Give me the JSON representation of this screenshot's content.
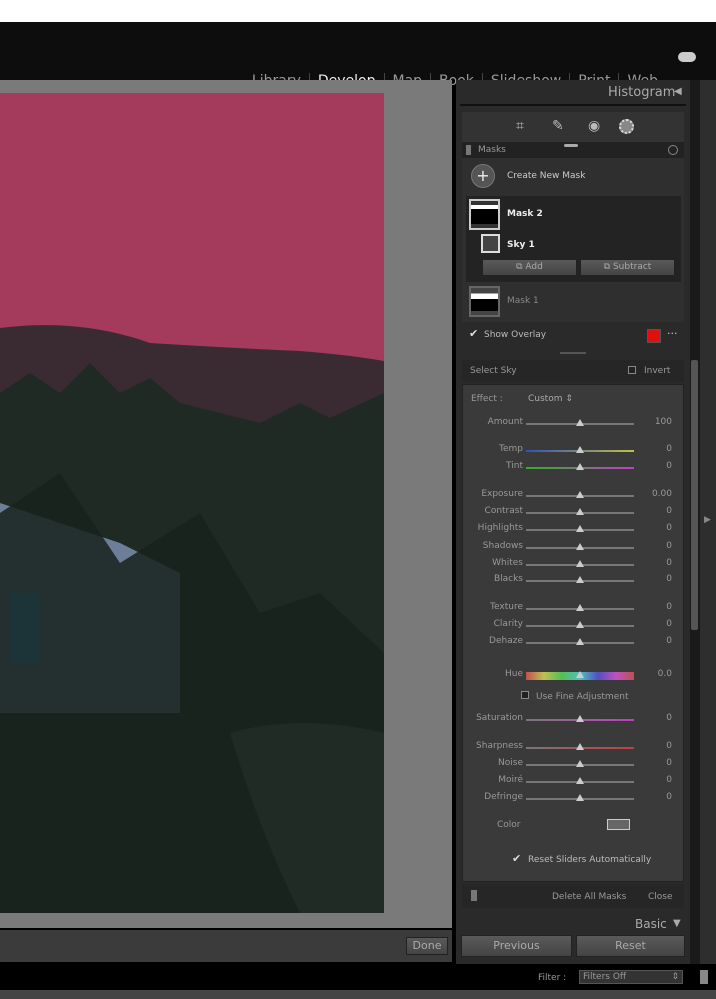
{
  "modules": [
    "Library",
    "Develop",
    "Map",
    "Book",
    "Slideshow",
    "Print",
    "Web"
  ],
  "active_module": "Develop",
  "panel": {
    "histogram": "Histogram",
    "basic": "Basic"
  },
  "masks": {
    "title": "Masks",
    "create": "Create New Mask",
    "mask2": "Mask 2",
    "sky1": "Sky 1",
    "add": "Add",
    "subtract": "Subtract",
    "mask1": "Mask 1",
    "show_overlay": "Show Overlay",
    "overlay_color": "#e01010"
  },
  "select": {
    "label": "Select Sky",
    "invert": "Invert"
  },
  "effect": {
    "label": "Effect :",
    "value": "Custom"
  },
  "sliders": [
    {
      "name": "Amount",
      "value": "100",
      "pos": 0.5,
      "group": 0
    },
    {
      "name": "Temp",
      "value": "0",
      "pos": 0.5,
      "group": 1,
      "track": "linear-gradient(90deg,#3050c0,#c0c040)"
    },
    {
      "name": "Tint",
      "value": "0",
      "pos": 0.5,
      "group": 1,
      "track": "linear-gradient(90deg,#30b030,#c040c0)"
    },
    {
      "name": "Exposure",
      "value": "0.00",
      "pos": 0.5,
      "group": 2
    },
    {
      "name": "Contrast",
      "value": "0",
      "pos": 0.5,
      "group": 2
    },
    {
      "name": "Highlights",
      "value": "0",
      "pos": 0.5,
      "group": 2
    },
    {
      "name": "Shadows",
      "value": "0",
      "pos": 0.5,
      "group": 2
    },
    {
      "name": "Whites",
      "value": "0",
      "pos": 0.5,
      "group": 2
    },
    {
      "name": "Blacks",
      "value": "0",
      "pos": 0.5,
      "group": 2
    },
    {
      "name": "Texture",
      "value": "0",
      "pos": 0.5,
      "group": 3
    },
    {
      "name": "Clarity",
      "value": "0",
      "pos": 0.5,
      "group": 3
    },
    {
      "name": "Dehaze",
      "value": "0",
      "pos": 0.5,
      "group": 3
    },
    {
      "name": "Hue",
      "value": "0.0",
      "pos": 0.5,
      "group": 4,
      "track": "linear-gradient(90deg,#c05050,#c0c050,#50c050,#50c0c0,#5050c0,#c050c0,#c05050)"
    },
    {
      "name": "Saturation",
      "value": "0",
      "pos": 0.5,
      "group": 5,
      "track": "linear-gradient(90deg,#777,#c040c0)"
    },
    {
      "name": "Sharpness",
      "value": "0",
      "pos": 0.5,
      "group": 6,
      "track": "linear-gradient(90deg,#777,#c04040)"
    },
    {
      "name": "Noise",
      "value": "0",
      "pos": 0.5,
      "group": 6
    },
    {
      "name": "Moiré",
      "value": "0",
      "pos": 0.5,
      "group": 6
    },
    {
      "name": "Defringe",
      "value": "0",
      "pos": 0.5,
      "group": 6
    }
  ],
  "fine_adjust": "Use Fine Adjustment",
  "color_label": "Color",
  "reset_auto": "Reset Sliders Automatically",
  "delete_all": "Delete All Masks",
  "close": "Close",
  "done": "Done",
  "previous": "Previous",
  "reset": "Reset",
  "filter": {
    "label": "Filter :",
    "value": "Filters Off"
  }
}
